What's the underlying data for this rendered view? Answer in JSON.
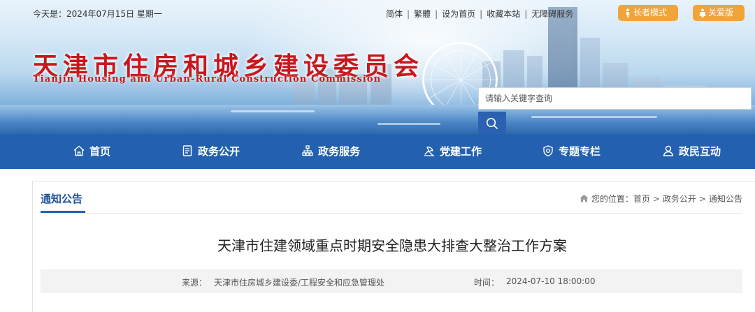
{
  "header": {
    "date_text": "今天是：2024年07月15日 星期一",
    "links": {
      "simplified": "简体",
      "traditional": "繁體",
      "set_homepage": "设为首页",
      "bookmark": "收藏本站",
      "accessibility": "无障碍服务"
    },
    "elder_mode_label": "长者模式",
    "care_version_label": "关爱版",
    "site_title": "天津市住房和城乡建设委员会",
    "site_subtitle": "Tianjin Housing and Urban-Rural Construction Commission",
    "search": {
      "placeholder": "请输入关键字查询",
      "icon": "search-icon"
    }
  },
  "nav": {
    "items": [
      {
        "label": "首页",
        "icon": "home-icon"
      },
      {
        "label": "政务公开",
        "icon": "document-icon"
      },
      {
        "label": "政务服务",
        "icon": "org-chart-icon"
      },
      {
        "label": "党建工作",
        "icon": "party-icon"
      },
      {
        "label": "专题专栏",
        "icon": "topic-icon"
      },
      {
        "label": "政民互动",
        "icon": "user-icon"
      }
    ]
  },
  "section": {
    "tab_label": "通知公告",
    "breadcrumb": {
      "prefix": "您的位置：",
      "items": [
        "首页",
        "政务公开",
        "通知公告"
      ]
    }
  },
  "article": {
    "title": "天津市住建领域重点时期安全隐患大排查大整治工作方案",
    "source_label": "来源：",
    "source_value": "天津市住房城乡建设委/工程安全和应急管理处",
    "time_label": "时间：",
    "time_value": "2024-07-10 18:00:00"
  },
  "colors": {
    "nav_bg": "#2361b0",
    "title_red": "#c9161d",
    "pill_orange": "#f0a43a",
    "section_blue": "#1d4f9c"
  }
}
